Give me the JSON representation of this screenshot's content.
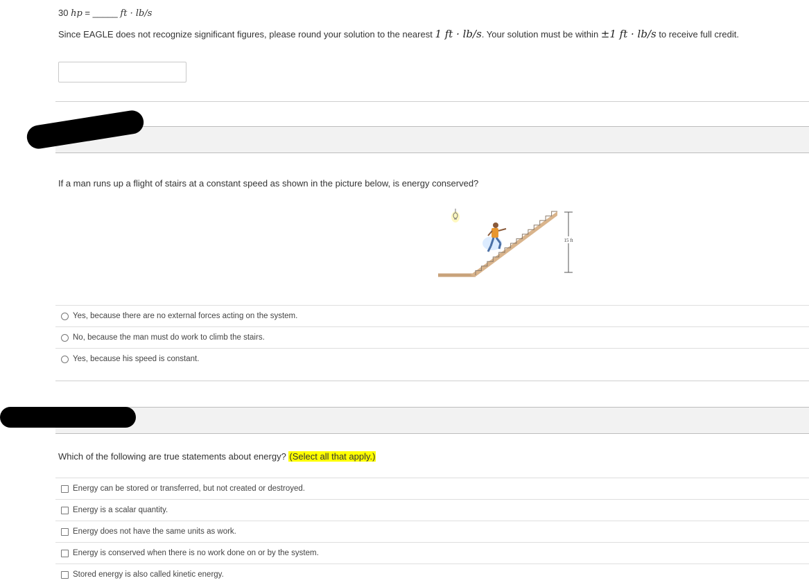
{
  "problem1": {
    "lhs_value": "30",
    "lhs_unit": "hp",
    "equals": "=",
    "blank": "_____",
    "rhs_unit": "ft · lb/s",
    "note_before": "Since EAGLE does not recognize significant figures, please round your solution to the nearest ",
    "note_precision": "1 ft · lb/s",
    "note_middle": ". Your solution must be within ",
    "note_tolerance": "±1 ft · lb/s",
    "note_after": " to receive full credit.",
    "answer_value": ""
  },
  "problem2": {
    "question": "If a man runs up a flight of stairs at a constant speed as shown in the picture below, is energy conserved?",
    "figure_label": "15 ft",
    "options": [
      "Yes, because there are no external forces acting on the system.",
      "No, because the man must do work to climb the stairs.",
      "Yes, because his speed is constant."
    ]
  },
  "problem3": {
    "question": "Which of the following are true statements about energy?",
    "instruction": "(Select all that apply.)",
    "options": [
      "Energy can be stored or transferred, but not created or destroyed.",
      "Energy is a scalar quantity.",
      "Energy does not have the same units as work.",
      "Energy is conserved when there is no work done on or by the system.",
      "Stored energy is also called kinetic energy."
    ]
  },
  "colors": {
    "highlight": "#ffff00",
    "redaction": "#000000",
    "stairs": "#c8a27a"
  }
}
